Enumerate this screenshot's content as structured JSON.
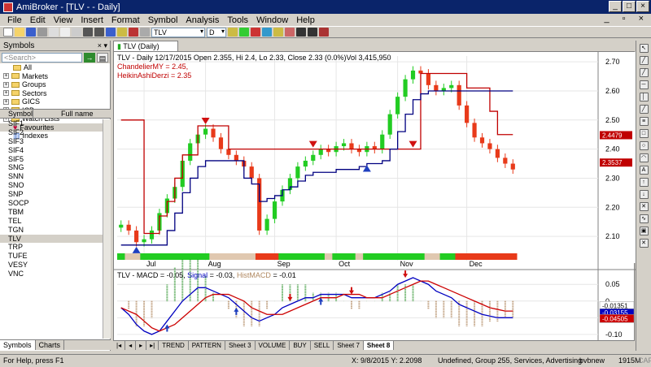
{
  "window": {
    "title": "AmiBroker - [TLV - - Daily]"
  },
  "menu": [
    "File",
    "Edit",
    "View",
    "Insert",
    "Format",
    "Symbol",
    "Analysis",
    "Tools",
    "Window",
    "Help"
  ],
  "toolbar": {
    "symbol": "TLV",
    "interval": "D"
  },
  "symbols_panel": {
    "title": "Symbols",
    "search_placeholder": "<Search>",
    "tree": [
      "All",
      "Markets",
      "Groups",
      "Sectors",
      "GICS",
      "ICB",
      "Watch Lists",
      "Favourites",
      "Indexes"
    ],
    "col_symbol": "Symbol",
    "col_fullname": "Full name",
    "list": [
      "SIF1",
      "SIF2",
      "SIF3",
      "SIF4",
      "SIF5",
      "SNG",
      "SNN",
      "SNO",
      "SNP",
      "SOCP",
      "TBM",
      "TEL",
      "TGN",
      "TLV",
      "TRP",
      "TUFE",
      "VESY",
      "VNC"
    ],
    "selected": "TLV",
    "tabs": [
      "Symbols",
      "Charts"
    ]
  },
  "chart_tab": "TLV (Daily)",
  "price_pane": {
    "header": "TLV - Daily 12/17/2015 Open 2.355, Hi 2.4, Lo 2.33, Close 2.33 (0.0%)Vol 3,415,950",
    "line2": "ChandelierMY = 2.45,",
    "line3": "HeikinAshiDerzi = 2.35",
    "y_ticks": [
      "2.70",
      "2.60",
      "2.50",
      "2.40",
      "2.30",
      "2.20",
      "2.10"
    ],
    "badge1": "2.4479",
    "badge2": "2.3537"
  },
  "macd_pane": {
    "title": "TLV - MACD",
    "macd_val": " = -0.05, ",
    "signal_lbl": "Signal",
    "signal_val": " = -0.03, ",
    "hist_lbl": "HistMACD",
    "hist_val": " = -0.01",
    "y_ticks": [
      "0.05",
      "0",
      "-0.05",
      "-0.10"
    ],
    "badges": [
      "-0.01351",
      "-0.03155",
      "-0.04505"
    ]
  },
  "x_months": [
    "Jul",
    "Aug",
    "Sep",
    "Oct",
    "Nov",
    "Dec"
  ],
  "sheets": [
    "TREND",
    "PATTERN",
    "Sheet 3",
    "VOLUME",
    "BUY",
    "SELL",
    "Sheet 7",
    "Sheet 8"
  ],
  "active_sheet": "Sheet 8",
  "status": {
    "left": "For Help, press F1",
    "coords": "X: 9/8/2015  Y: 2.2098",
    "info": "Undefined, Group 255, Services, Advertising",
    "db": "bvbnew",
    "mem": "1915M",
    "cap": "CAP"
  },
  "colors": {
    "bull": "#22cc22",
    "bear": "#e83a1a",
    "chandelier": "#c00000",
    "trail": "#000080",
    "macd_line": "#0000c0",
    "signal_line": "#cc0000"
  },
  "chart_data": {
    "type": "line",
    "series": [
      {
        "values": [
          2.14,
          2.12,
          2.08,
          2.09,
          2.12,
          2.18,
          2.23,
          2.27,
          2.36,
          2.42,
          2.45,
          2.47,
          2.44,
          2.4,
          2.38,
          2.36,
          2.34,
          2.3,
          2.12,
          2.16,
          2.22,
          2.26,
          2.3,
          2.34,
          2.36,
          2.38,
          2.4,
          2.39,
          2.41,
          2.42,
          2.4,
          2.39,
          2.41,
          2.4,
          2.45,
          2.52,
          2.58,
          2.64,
          2.67,
          2.66,
          2.62,
          2.6,
          2.61,
          2.62,
          2.55,
          2.49,
          2.44,
          2.42,
          2.4,
          2.37,
          2.35,
          2.33
        ]
      },
      {
        "name": "ChandelierMY",
        "values": [
          2.5,
          2.5,
          2.5,
          2.11,
          2.11,
          2.17,
          2.22,
          2.3,
          2.38,
          2.38,
          2.48,
          2.48,
          2.48,
          2.48,
          2.4,
          2.4,
          2.4,
          2.4,
          2.4,
          2.4,
          2.4,
          2.4,
          2.4,
          2.4,
          2.4,
          2.4,
          2.4,
          2.4,
          2.4,
          2.4,
          2.4,
          2.4,
          2.4,
          2.4,
          2.4,
          2.4,
          2.4,
          2.4,
          2.4,
          2.66,
          2.66,
          2.66,
          2.66,
          2.66,
          2.66,
          2.61,
          2.61,
          2.61,
          2.53,
          2.45,
          2.45,
          2.45
        ]
      },
      {
        "name": "HeikinAshiDerzi",
        "values": [
          2.07,
          2.07,
          2.07,
          2.07,
          2.07,
          2.07,
          2.12,
          2.18,
          2.25,
          2.3,
          2.34,
          2.36,
          2.36,
          2.36,
          2.36,
          2.36,
          2.3,
          2.28,
          2.22,
          2.23,
          2.24,
          2.26,
          2.27,
          2.29,
          2.31,
          2.32,
          2.32,
          2.32,
          2.33,
          2.33,
          2.33,
          2.34,
          2.35,
          2.35,
          2.36,
          2.4,
          2.46,
          2.52,
          2.57,
          2.59,
          2.6,
          2.6,
          2.6,
          2.6,
          2.6,
          2.6,
          2.6,
          2.6,
          2.6,
          2.6,
          2.6,
          2.6
        ]
      },
      {
        "name": "MACD",
        "values": [
          -0.02,
          -0.04,
          -0.07,
          -0.09,
          -0.1,
          -0.09,
          -0.06,
          -0.03,
          0.0,
          0.02,
          0.04,
          0.04,
          0.03,
          0.02,
          0.01,
          -0.01,
          -0.03,
          -0.05,
          -0.06,
          -0.05,
          -0.04,
          -0.02,
          -0.01,
          0.0,
          0.01,
          0.01,
          0.02,
          0.02,
          0.02,
          0.02,
          0.01,
          0.01,
          0.01,
          0.01,
          0.02,
          0.03,
          0.05,
          0.06,
          0.07,
          0.06,
          0.05,
          0.03,
          0.02,
          0.01,
          -0.01,
          -0.02,
          -0.03,
          -0.04,
          -0.045,
          -0.05,
          -0.05,
          -0.05
        ]
      },
      {
        "name": "Signal",
        "values": [
          -0.02,
          -0.03,
          -0.04,
          -0.06,
          -0.08,
          -0.09,
          -0.08,
          -0.07,
          -0.05,
          -0.03,
          -0.01,
          0.01,
          0.02,
          0.02,
          0.02,
          0.01,
          0.0,
          -0.02,
          -0.03,
          -0.04,
          -0.04,
          -0.04,
          -0.03,
          -0.02,
          -0.01,
          0.0,
          0.01,
          0.01,
          0.01,
          0.02,
          0.02,
          0.02,
          0.01,
          0.01,
          0.01,
          0.02,
          0.03,
          0.04,
          0.05,
          0.06,
          0.06,
          0.05,
          0.04,
          0.03,
          0.02,
          0.01,
          0.0,
          -0.01,
          -0.02,
          -0.025,
          -0.03,
          -0.03
        ]
      }
    ],
    "ylim": [
      2.05,
      2.72
    ]
  }
}
